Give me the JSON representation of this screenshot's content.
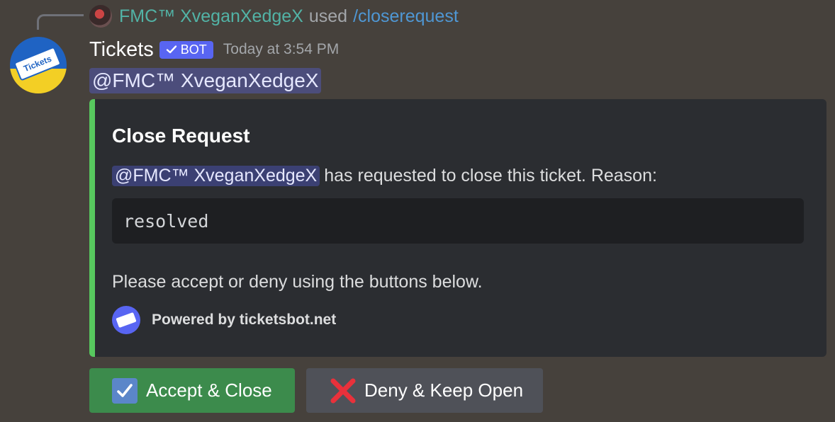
{
  "reply": {
    "username": "FMC™ XveganXedgeX",
    "used_text": "used",
    "command": "/closerequest",
    "avatar_icon": "user-avatar"
  },
  "message": {
    "bot_name": "Tickets",
    "bot_badge": "BOT",
    "timestamp": "Today at 3:54 PM",
    "mention": "@FMC™ XveganXedgeX",
    "avatar_icon": "tickets-bot-avatar",
    "avatar_ticket_text": "Tickets"
  },
  "embed": {
    "accent_color": "#57c85e",
    "title": "Close Request",
    "mention": "@FMC™ XveganXedgeX",
    "description": "has requested to close this ticket. Reason:",
    "reason": "resolved",
    "note": "Please accept or deny using the buttons below.",
    "footer_text": "Powered by ticketsbot.net",
    "footer_icon": "tickets-logo-icon"
  },
  "buttons": {
    "accept_label": "Accept & Close",
    "accept_icon": "check-mark-button-icon",
    "accept_color": "#3c8b4c",
    "deny_label": "Deny & Keep Open",
    "deny_icon": "cross-mark-icon",
    "deny_color": "#4f5158"
  }
}
